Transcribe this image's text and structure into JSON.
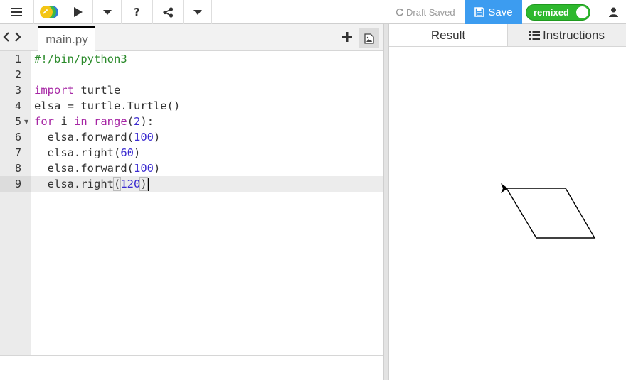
{
  "toolbar": {
    "draft_status": "Draft Saved",
    "save_label": "Save",
    "remix_label": "remixed",
    "help_label": "?"
  },
  "editor": {
    "active_file": "main.py",
    "line_numbers": [
      "1",
      "2",
      "3",
      "4",
      "5",
      "6",
      "7",
      "8",
      "9"
    ],
    "current_line": 9
  },
  "output": {
    "tabs": [
      {
        "label": "Result"
      },
      {
        "label": "Instructions"
      }
    ],
    "active_tab": "Result"
  },
  "colors": {
    "accent": "#3c9cf0",
    "remix_green": "#2eb82e",
    "keyword": "#a626a4",
    "comment": "#2a8a2a",
    "number": "#3b2bd0"
  },
  "icons": [
    "menu-icon",
    "logo-icon",
    "play-icon",
    "caret-down-icon",
    "share-icon",
    "refresh-icon",
    "floppy-icon",
    "user-icon",
    "chevron-left-icon",
    "chevron-right-icon",
    "plus-icon",
    "image-icon",
    "list-icon",
    "turtle-arrow-icon"
  ]
}
